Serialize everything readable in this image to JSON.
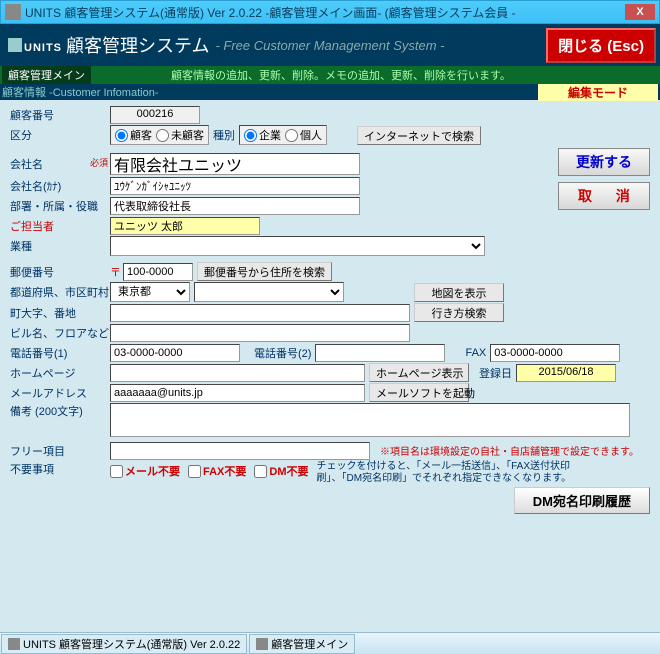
{
  "window": {
    "title": "UNITS 顧客管理システム(通常版)  Ver 2.0.22 -顧客管理メイン画面- (顧客管理システム会員 -"
  },
  "header": {
    "brand": "UNITS",
    "brand_sub": "顧客管理システム",
    "brand_eng": "- Free Customer Management System -",
    "close": "閉じる (Esc)"
  },
  "subheader": {
    "main": "顧客管理メイン",
    "desc": "顧客情報の追加、更新、削除。メモの追加、更新、削除を行います。"
  },
  "section": {
    "label": "顧客情報 -Customer Infomation-",
    "mode": "編集モード"
  },
  "side": {
    "update": "更新する",
    "cancel": "取  消"
  },
  "form": {
    "customer_no_lbl": "顧客番号",
    "customer_no": "000216",
    "kubun_lbl": "区分",
    "kubun_opt1": "顧客",
    "kubun_opt2": "未顧客",
    "type_lbl": "種別",
    "type_opt1": "企業",
    "type_opt2": "個人",
    "internet_btn": "インターネットで検索",
    "company_lbl": "会社名",
    "required": "必須",
    "company": "有限会社ユニッツ",
    "company_kana_lbl": "会社名(ｶﾅ)",
    "company_kana": "ﾕｳｹﾞﾝｶﾞｲｼｬﾕﾆｯﾂ",
    "dept_lbl": "部署・所属・役職",
    "dept": "代表取締役社長",
    "contact_lbl": "ご担当者",
    "contact": "ユニッツ 太郎",
    "industry_lbl": "業種",
    "postal_lbl": "郵便番号",
    "postal_mark": "〒",
    "postal": "100-0000",
    "postal_btn": "郵便番号から住所を検索",
    "pref_lbl": "都道府県、市区町村",
    "pref": "東京都",
    "map_btn": "地図を表示",
    "addr1_lbl": "町大字、番地",
    "route_btn": "行き方検索",
    "addr2_lbl": "ビル名、フロアなど",
    "tel1_lbl": "電話番号(1)",
    "tel1": "03-0000-0000",
    "tel2_lbl": "電話番号(2)",
    "fax_lbl": "FAX",
    "fax": "03-0000-0000",
    "hp_lbl": "ホームページ",
    "hp_btn": "ホームページ表示",
    "reg_lbl": "登録日",
    "reg_date": "2015/06/18",
    "mail_lbl": "メールアドレス",
    "mail": "aaaaaaa@units.jp",
    "mail_btn": "メールソフトを起動",
    "memo_lbl": "備考 (200文字)",
    "free_lbl": "フリー項目",
    "free_note": "※項目名は環境設定の自社・自店舗管理で設定できます。",
    "fuyo_lbl": "不要事項",
    "chk1": "メール不要",
    "chk2": "FAX不要",
    "chk3": "DM不要",
    "fuyo_hint": "チェックを付けると、「メール一括送信」、「FAX送付状印刷」、「DM宛名印刷」でそれぞれ指定できなくなります。",
    "dm_btn": "DM宛名印刷履歴"
  },
  "taskbar": {
    "item1": "UNITS 顧客管理システム(通常版)  Ver 2.0.22",
    "item2": "顧客管理メイン"
  }
}
